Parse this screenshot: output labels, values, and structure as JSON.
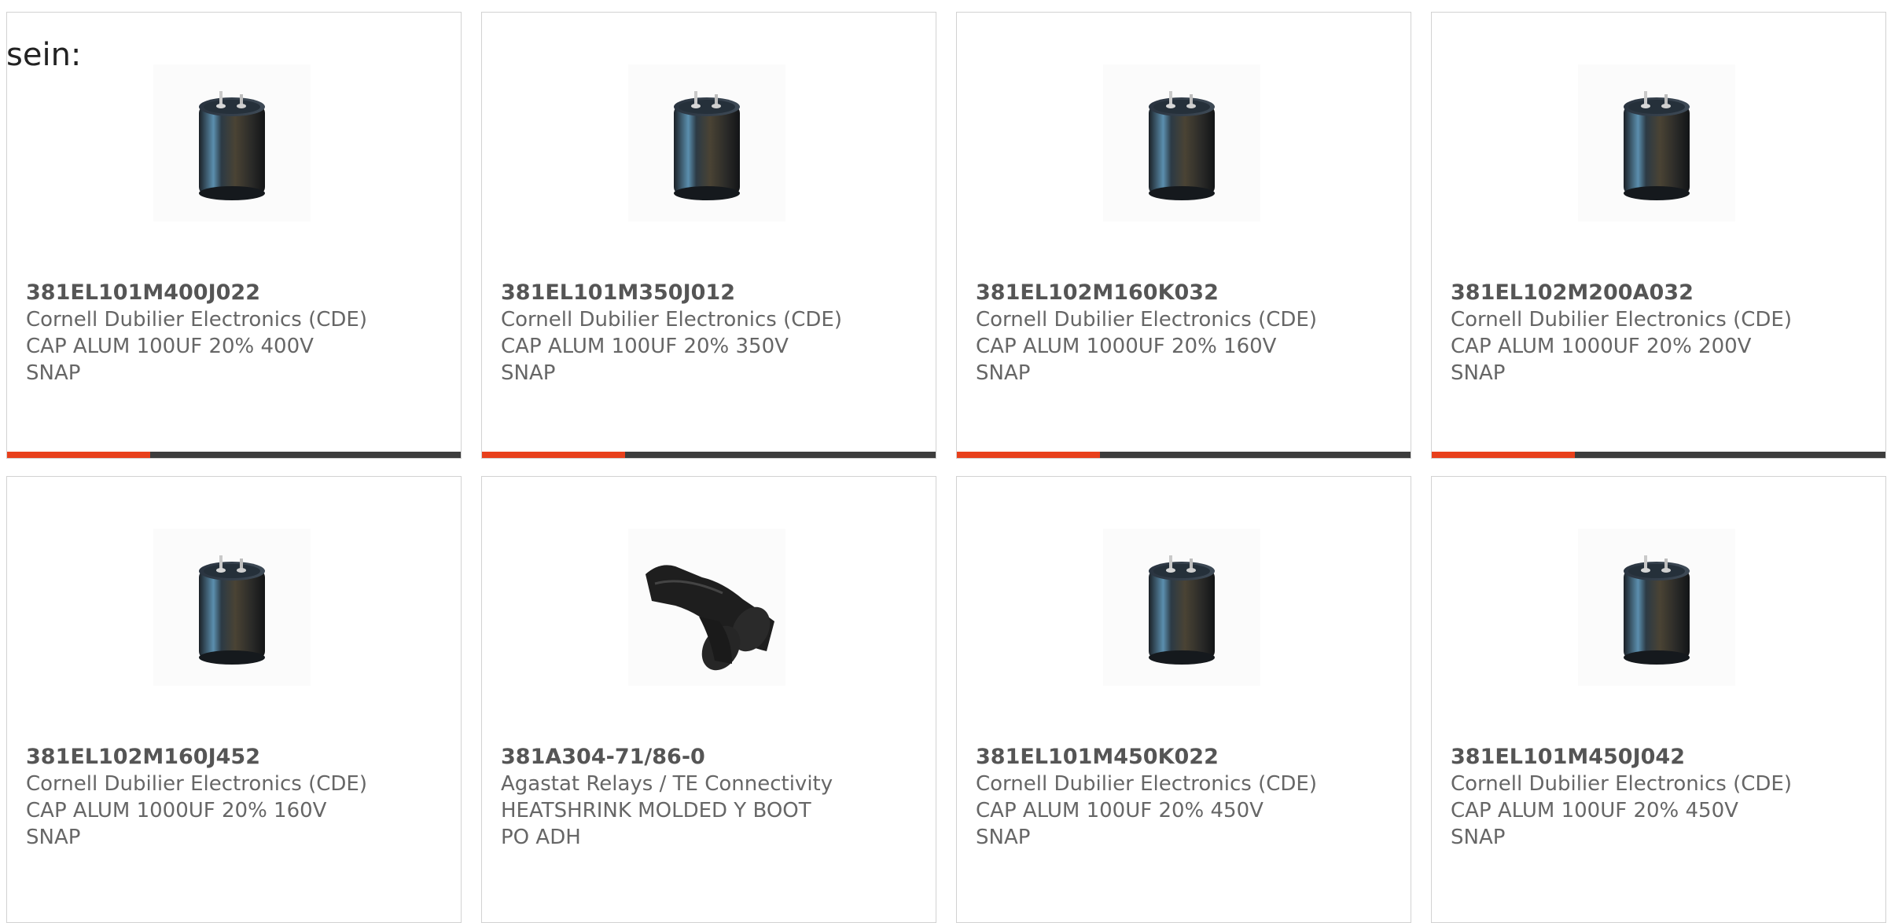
{
  "page": {
    "lead_text": "sein:"
  },
  "colors": {
    "accent": "#e8401c",
    "track": "#3d3d3d",
    "border": "#d2d2d2",
    "text": "#555555"
  },
  "products": [
    {
      "part_number": "381EL101M400J022",
      "manufacturer": "Cornell Dubilier Electronics (CDE)",
      "description": "CAP ALUM 100UF 20% 400V\nSNAP",
      "image": "electrolytic-capacitor-icon",
      "progress": 0.315
    },
    {
      "part_number": "381EL101M350J012",
      "manufacturer": "Cornell Dubilier Electronics (CDE)",
      "description": "CAP ALUM 100UF 20% 350V\nSNAP",
      "image": "electrolytic-capacitor-icon",
      "progress": 0.315
    },
    {
      "part_number": "381EL102M160K032",
      "manufacturer": "Cornell Dubilier Electronics (CDE)",
      "description": "CAP ALUM 1000UF 20% 160V\nSNAP",
      "image": "electrolytic-capacitor-icon",
      "progress": 0.315
    },
    {
      "part_number": "381EL102M200A032",
      "manufacturer": "Cornell Dubilier Electronics (CDE)",
      "description": "CAP ALUM 1000UF 20% 200V\nSNAP",
      "image": "electrolytic-capacitor-icon",
      "progress": 0.315
    },
    {
      "part_number": "381EL102M160J452",
      "manufacturer": "Cornell Dubilier Electronics (CDE)",
      "description": "CAP ALUM 1000UF 20% 160V\nSNAP",
      "image": "electrolytic-capacitor-icon",
      "progress": null
    },
    {
      "part_number": "381A304-71/86-0",
      "manufacturer": "Agastat Relays / TE Connectivity",
      "description": "HEATSHRINK MOLDED Y BOOT\nPO ADH",
      "image": "heatshrink-boot-icon",
      "progress": null
    },
    {
      "part_number": "381EL101M450K022",
      "manufacturer": "Cornell Dubilier Electronics (CDE)",
      "description": "CAP ALUM 100UF 20% 450V\nSNAP",
      "image": "electrolytic-capacitor-icon",
      "progress": null
    },
    {
      "part_number": "381EL101M450J042",
      "manufacturer": "Cornell Dubilier Electronics (CDE)",
      "description": "CAP ALUM 100UF 20% 450V\nSNAP",
      "image": "electrolytic-capacitor-icon",
      "progress": null
    }
  ]
}
